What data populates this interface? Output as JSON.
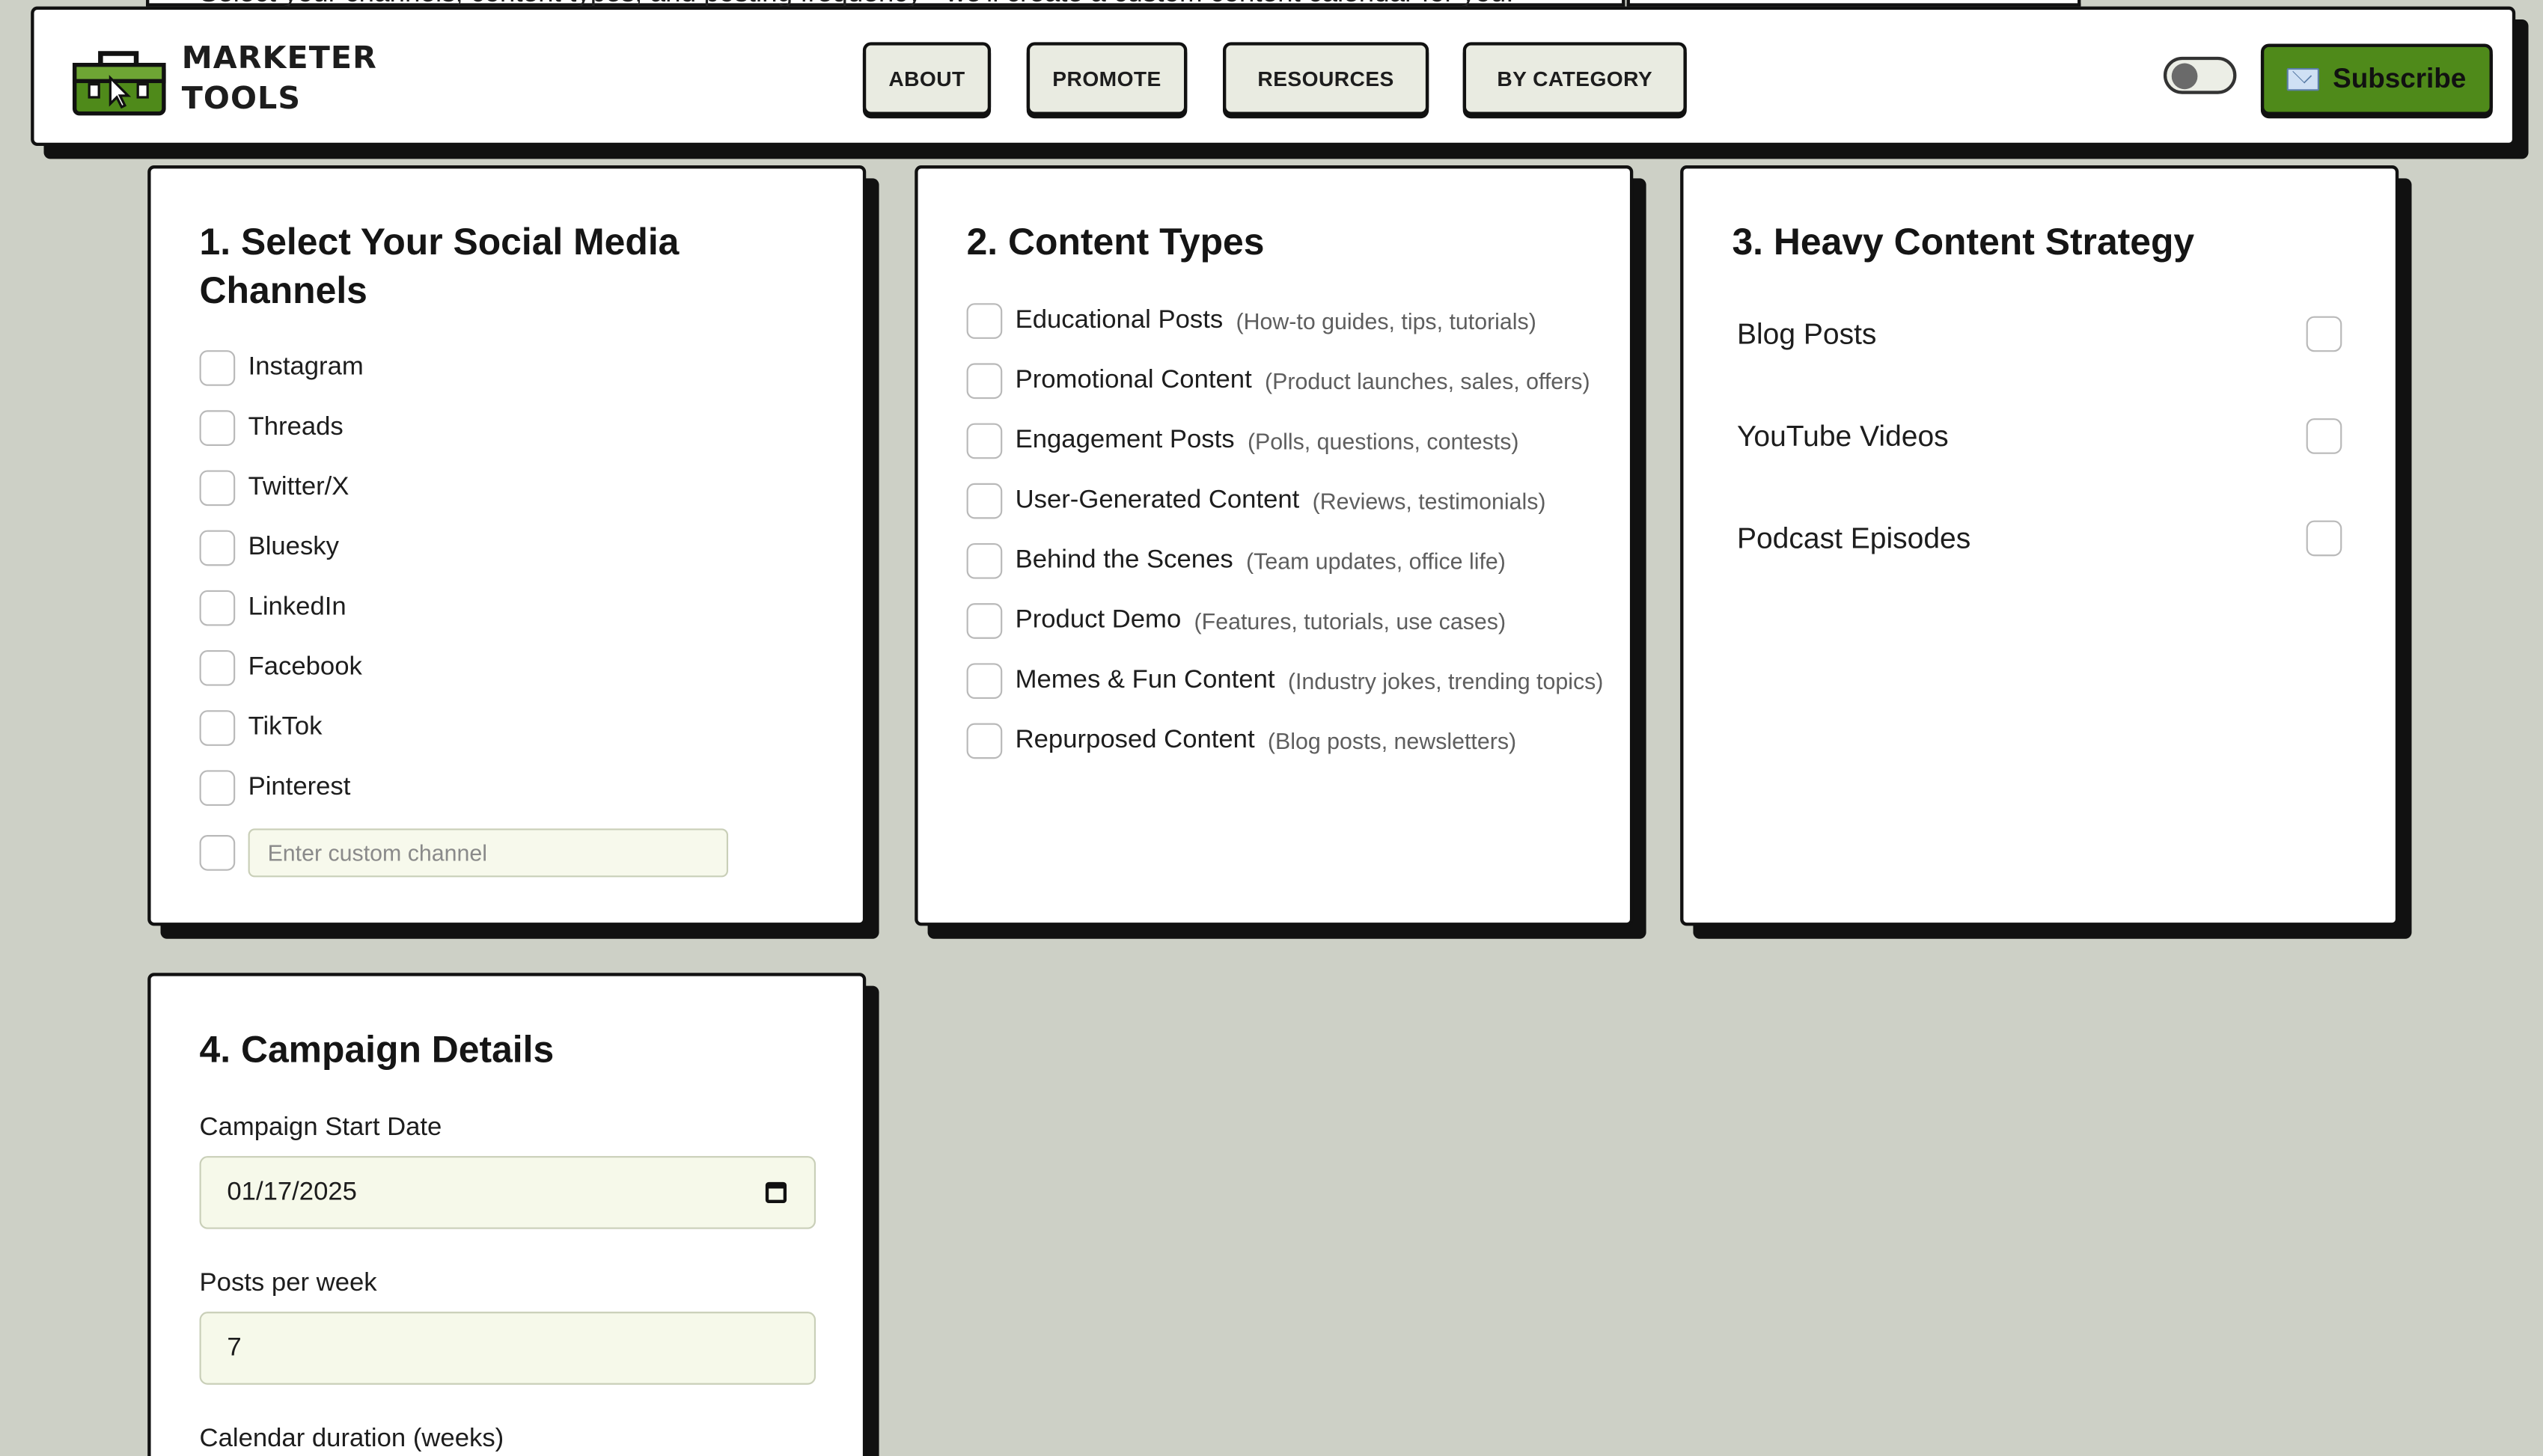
{
  "background_text": "Select your channels, content types, and posting frequency - we'll create a custom content calendar for you.",
  "header": {
    "brand_line1": "MARKETER",
    "brand_line2": "TOOLS",
    "nav": [
      "ABOUT",
      "PROMOTE",
      "RESOURCES",
      "BY CATEGORY"
    ],
    "subscribe_label": "Subscribe",
    "subscribe_icon": "envelope-icon",
    "accent": "#4f8a1a"
  },
  "section1": {
    "title": "1. Select Your Social Media Channels",
    "channels": [
      "Instagram",
      "Threads",
      "Twitter/X",
      "Bluesky",
      "LinkedIn",
      "Facebook",
      "TikTok",
      "Pinterest"
    ],
    "custom_placeholder": "Enter custom channel"
  },
  "section2": {
    "title": "2. Content Types",
    "types": [
      {
        "label": "Educational Posts",
        "desc": "(How-to guides, tips, tutorials)"
      },
      {
        "label": "Promotional Content",
        "desc": "(Product launches, sales, offers)"
      },
      {
        "label": "Engagement Posts",
        "desc": "(Polls, questions, contests)"
      },
      {
        "label": "User-Generated Content",
        "desc": "(Reviews, testimonials)"
      },
      {
        "label": "Behind the Scenes",
        "desc": "(Team updates, office life)"
      },
      {
        "label": "Product Demo",
        "desc": "(Features, tutorials, use cases)"
      },
      {
        "label": "Memes & Fun Content",
        "desc": "(Industry jokes, trending topics)"
      },
      {
        "label": "Repurposed Content",
        "desc": "(Blog posts, newsletters)"
      }
    ]
  },
  "section3": {
    "title": "3. Heavy Content Strategy",
    "items": [
      "Blog Posts",
      "YouTube Videos",
      "Podcast Episodes"
    ]
  },
  "section4": {
    "title": "4. Campaign Details",
    "start_label": "Campaign Start Date",
    "start_value": "01/17/2025",
    "posts_label": "Posts per week",
    "posts_value": "7",
    "duration_label": "Calendar duration (weeks)"
  }
}
